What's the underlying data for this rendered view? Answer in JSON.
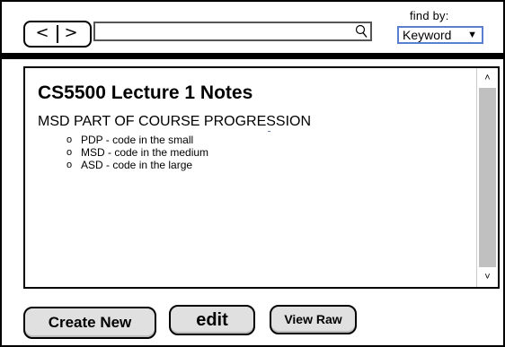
{
  "nav": {
    "back_label": "<",
    "forward_label": ">"
  },
  "search": {
    "value": "",
    "placeholder": ""
  },
  "find_by": {
    "label": "find by:",
    "selected": "Keyword",
    "arrow": "▼"
  },
  "document": {
    "title": "CS5500 Lecture 1 Notes",
    "heading": "MSD PART OF COURSE PROGRESSION",
    "bullet": "o",
    "items": [
      "PDP - code in the small",
      "MSD - code in the medium",
      "ASD - code in the large"
    ]
  },
  "scroll": {
    "up": "˄",
    "down": "˅"
  },
  "buttons": {
    "create": "Create New",
    "edit": "edit",
    "view_raw": "View Raw"
  }
}
